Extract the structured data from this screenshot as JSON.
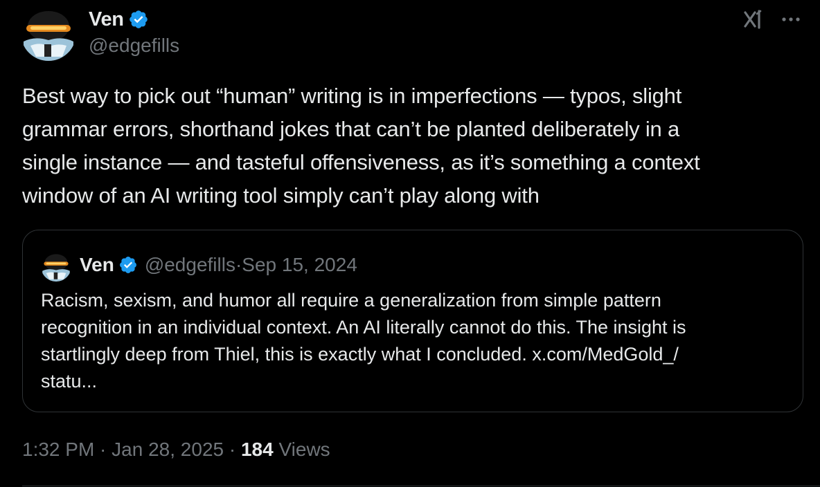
{
  "author": {
    "display_name": "Ven",
    "handle": "@edgefills",
    "verified_icon": "verified-badge-icon",
    "avatar_icon": "avatar"
  },
  "header_actions": {
    "grok_icon": "grok-icon",
    "more_icon": "more-options-icon"
  },
  "tweet": {
    "text": "Best way to pick out “human” writing is in imperfections — typos, slight\ngrammar errors, shorthand jokes that can’t be planted deliberately in a\nsingle instance — and tasteful offensiveness, as it’s something a context\nwindow of an AI writing tool simply can’t play along with",
    "time": "1:32 PM",
    "separator1": " · ",
    "date": "Jan 28, 2025",
    "separator2": " · ",
    "views_count": "184",
    "views_label": " Views"
  },
  "quoted_tweet": {
    "display_name": "Ven",
    "handle": "@edgefills",
    "separator": " · ",
    "date": "Sep 15, 2024",
    "text": "Racism, sexism, and humor all require a generalization from simple pattern\nrecognition in an individual context. An AI literally cannot do this. The insight is\nstartlingly deep from Thiel, this is exactly what I concluded. x.com/MedGold_/\nstatu..."
  },
  "colors": {
    "background": "#000000",
    "text_primary": "#e7e9ea",
    "text_secondary": "#71767b",
    "verified_blue": "#1d9bf0",
    "border": "#2f3336"
  }
}
